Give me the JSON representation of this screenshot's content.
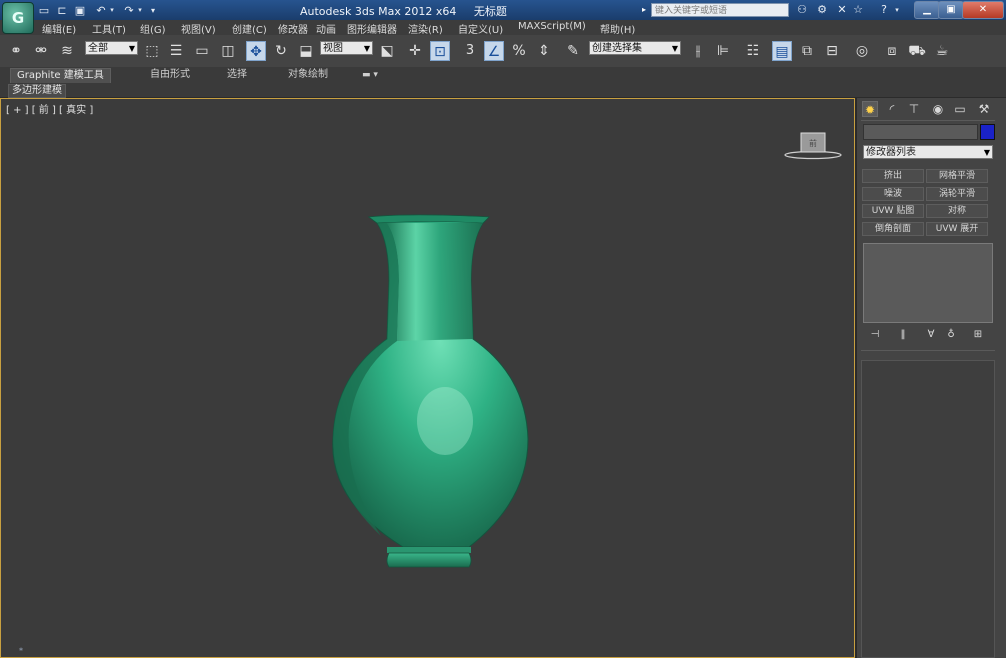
{
  "titlebar": {
    "app_title": "Autodesk 3ds Max  2012 x64",
    "document_title": "无标题",
    "search_placeholder": "键入关键字或短语",
    "app_logo_glyph": "G",
    "quick_access": [
      "new-file",
      "open-file",
      "save-file",
      "undo",
      "redo",
      "customize"
    ],
    "window_buttons": [
      "minimize",
      "restore",
      "close"
    ]
  },
  "menubar": {
    "items": [
      "编辑(E)",
      "工具(T)",
      "组(G)",
      "视图(V)",
      "创建(C)",
      "修改器",
      "动画",
      "图形编辑器",
      "渲染(R)",
      "自定义(U)",
      "MAXScript(M)",
      "帮助(H)"
    ]
  },
  "toolbar": {
    "selection_filter": "全部",
    "reference_coord": "视图",
    "named_selection": "创建选择集",
    "snap_angle_label": "3",
    "percent_snap_label": "%"
  },
  "ribbon": {
    "tabs": [
      "Graphite 建模工具",
      "自由形式",
      "选择",
      "对象绘制"
    ],
    "subtab": "多边形建模"
  },
  "viewport": {
    "label": "[ + ] [ 前 ] [ 真实 ]",
    "viewcube_face": "前",
    "object": "vase",
    "object_color": "#2e9e74",
    "background": "#3b3b3b"
  },
  "command_panel": {
    "tabs": [
      "create",
      "modify",
      "hierarchy",
      "motion",
      "display",
      "utilities"
    ],
    "active_tab": "create",
    "object_color": "#1a22c8",
    "modifier_list": "修改器列表",
    "modifier_buttons": [
      [
        "挤出",
        "网格平滑"
      ],
      [
        "噪波",
        "涡轮平滑"
      ],
      [
        "UVW 贴图",
        "对称"
      ],
      [
        "倒角剖面",
        "UVW 展开"
      ]
    ],
    "stack_icons": [
      "pin-stack",
      "show-end-result",
      "make-unique",
      "remove-modifier",
      "configure-sets"
    ]
  }
}
